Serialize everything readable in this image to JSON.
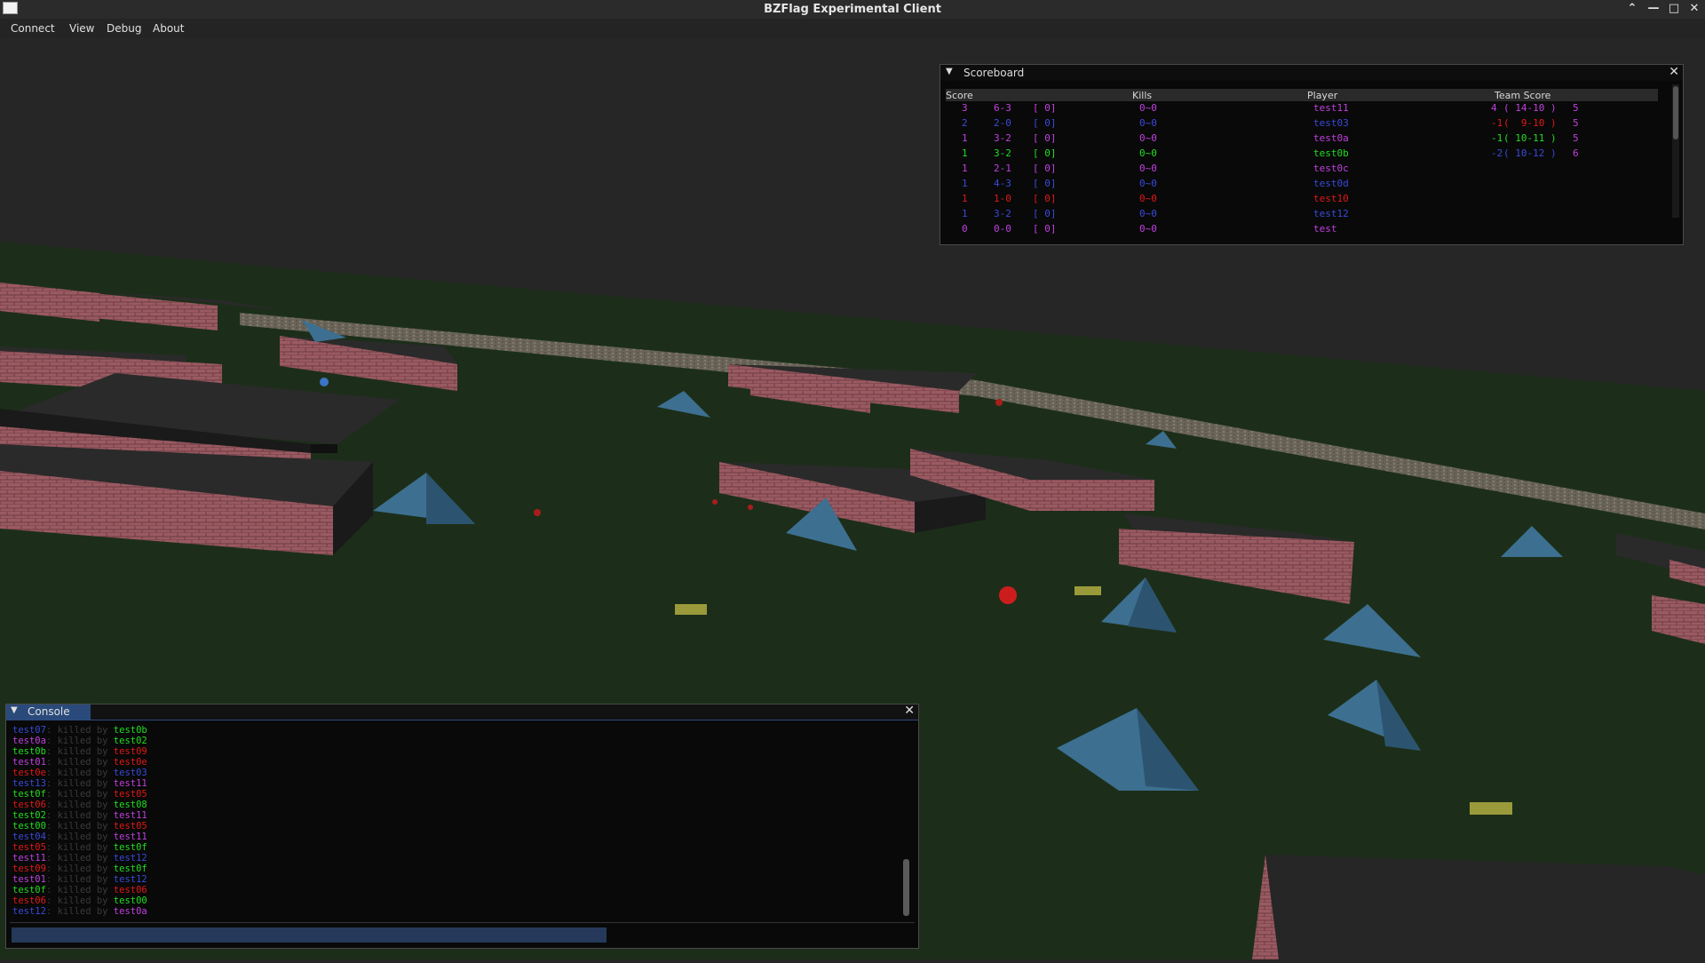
{
  "window": {
    "title": "BZFlag Experimental Client"
  },
  "menu": [
    "Connect",
    "View",
    "Debug",
    "About"
  ],
  "scoreboard": {
    "title": "Scoreboard",
    "headers": [
      "Score",
      "Kills",
      "Player",
      "Team Score"
    ],
    "rows": [
      {
        "score": "3",
        "wl": "6-3",
        "bracket": "[ 0]",
        "kills": "0~0",
        "player": "test11",
        "color": "#c040e0"
      },
      {
        "score": "2",
        "wl": "2-0",
        "bracket": "[ 0]",
        "kills": "0~0",
        "player": "test03",
        "color": "#3a4ad8"
      },
      {
        "score": "1",
        "wl": "3-2",
        "bracket": "[ 0]",
        "kills": "0~0",
        "player": "test0a",
        "color": "#c040e0"
      },
      {
        "score": "1",
        "wl": "3-2",
        "bracket": "[ 0]",
        "kills": "0~0",
        "player": "test0b",
        "color": "#22dd22"
      },
      {
        "score": "1",
        "wl": "2-1",
        "bracket": "[ 0]",
        "kills": "0~0",
        "player": "test0c",
        "color": "#c040e0"
      },
      {
        "score": "1",
        "wl": "4-3",
        "bracket": "[ 0]",
        "kills": "0~0",
        "player": "test0d",
        "color": "#3a4ad8"
      },
      {
        "score": "1",
        "wl": "1-0",
        "bracket": "[ 0]",
        "kills": "0~0",
        "player": "test10",
        "color": "#e01818"
      },
      {
        "score": "1",
        "wl": "3-2",
        "bracket": "[ 0]",
        "kills": "0~0",
        "player": "test12",
        "color": "#3a4ad8"
      },
      {
        "score": "0",
        "wl": "0-0",
        "bracket": "[ 0]",
        "kills": "0~0",
        "player": "test",
        "color": "#c040e0"
      }
    ],
    "team_rows": [
      {
        "score": "4",
        "detail": "( 14-10 )",
        "count": "5",
        "color": "#c040e0"
      },
      {
        "score": "-1",
        "detail": "(  9-10 )",
        "count": "5",
        "color": "#e01818"
      },
      {
        "score": "-1",
        "detail": "( 10-11 )",
        "count": "5",
        "color": "#22dd22"
      },
      {
        "score": "-2",
        "detail": "( 10-12 )",
        "count": "6",
        "color": "#3a4ad8"
      }
    ],
    "team_count_color": "#c040e0"
  },
  "console": {
    "title": "Console",
    "lines": [
      {
        "victim": "test07",
        "vc": "#3a4ad8",
        "text": ": killed by ",
        "killer": "test0b",
        "kc": "#22dd22"
      },
      {
        "victim": "test0a",
        "vc": "#c040e0",
        "text": ": killed by ",
        "killer": "test02",
        "kc": "#22dd22"
      },
      {
        "victim": "test0b",
        "vc": "#22dd22",
        "text": ": killed by ",
        "killer": "test09",
        "kc": "#e01818"
      },
      {
        "victim": "test01",
        "vc": "#c040e0",
        "text": ": killed by ",
        "killer": "test0e",
        "kc": "#e01818"
      },
      {
        "victim": "test0e",
        "vc": "#e01818",
        "text": ": killed by ",
        "killer": "test03",
        "kc": "#3a4ad8"
      },
      {
        "victim": "test13",
        "vc": "#3a4ad8",
        "text": ": killed by ",
        "killer": "test11",
        "kc": "#c040e0"
      },
      {
        "victim": "test0f",
        "vc": "#22dd22",
        "text": ": killed by ",
        "killer": "test05",
        "kc": "#e01818"
      },
      {
        "victim": "test06",
        "vc": "#e01818",
        "text": ": killed by ",
        "killer": "test08",
        "kc": "#22dd22"
      },
      {
        "victim": "test02",
        "vc": "#22dd22",
        "text": ": killed by ",
        "killer": "test11",
        "kc": "#c040e0"
      },
      {
        "victim": "test00",
        "vc": "#22dd22",
        "text": ": killed by ",
        "killer": "test05",
        "kc": "#e01818"
      },
      {
        "victim": "test04",
        "vc": "#3a4ad8",
        "text": ": killed by ",
        "killer": "test11",
        "kc": "#c040e0"
      },
      {
        "victim": "test05",
        "vc": "#e01818",
        "text": ": killed by ",
        "killer": "test0f",
        "kc": "#22dd22"
      },
      {
        "victim": "test11",
        "vc": "#c040e0",
        "text": ": killed by ",
        "killer": "test12",
        "kc": "#3a4ad8"
      },
      {
        "victim": "test09",
        "vc": "#e01818",
        "text": ": killed by ",
        "killer": "test0f",
        "kc": "#22dd22"
      },
      {
        "victim": "test01",
        "vc": "#c040e0",
        "text": ": killed by ",
        "killer": "test12",
        "kc": "#3a4ad8"
      },
      {
        "victim": "test0f",
        "vc": "#22dd22",
        "text": ": killed by ",
        "killer": "test06",
        "kc": "#e01818"
      },
      {
        "victim": "test06",
        "vc": "#e01818",
        "text": ": killed by ",
        "killer": "test00",
        "kc": "#22dd22"
      },
      {
        "victim": "test12",
        "vc": "#3a4ad8",
        "text": ": killed by ",
        "killer": "test0a",
        "kc": "#c040e0"
      }
    ],
    "input_value": ""
  },
  "icons": {
    "collapse": "triangle-down-icon",
    "close": "close-icon",
    "app": "app-icon",
    "titlebar_buttons": [
      "chevron-up-icon",
      "minimize-icon",
      "maximize-icon",
      "close-icon"
    ]
  }
}
